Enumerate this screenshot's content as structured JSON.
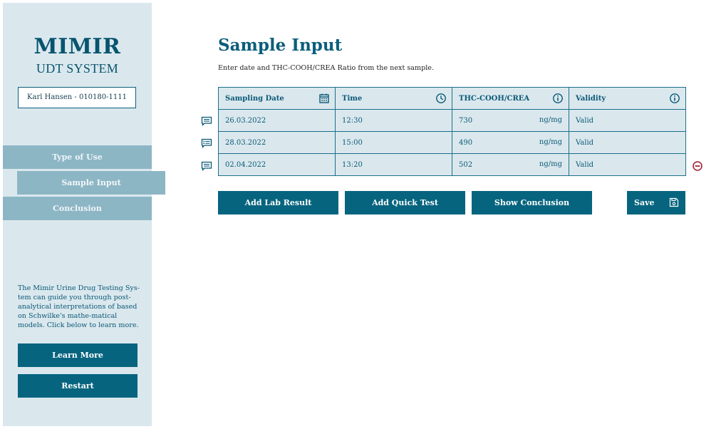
{
  "sidebar": {
    "brand_title": "MIMIR",
    "brand_subtitle": "UDT SYSTEM",
    "patient": "Karl Hansen - 010180-1111",
    "nav": [
      {
        "label": "Type of Use"
      },
      {
        "label": "Sample Input"
      },
      {
        "label": "Conclusion"
      }
    ],
    "info_text": "The Mimir Urine Drug Testing Sys-tem can guide you through post-analytical interpretations of based on Schwilke's mathe-matical models. Click below to learn more.",
    "learn_more": "Learn More",
    "restart": "Restart"
  },
  "main": {
    "title": "Sample Input",
    "subtitle": "Enter date and THC-COOH/CREA Ratio from the next sample.",
    "table": {
      "headers": [
        "Sampling Date",
        "Time",
        "THC-COOH/CREA",
        "Validity"
      ],
      "rows": [
        {
          "date": "26.03.2022",
          "time": "12:30",
          "value": "730",
          "unit": "ng/mg",
          "validity": "Valid"
        },
        {
          "date": "28.03.2022",
          "time": "15:00",
          "value": "490",
          "unit": "ng/mg",
          "validity": "Valid"
        },
        {
          "date": "02.04.2022",
          "time": "13:20",
          "value": "502",
          "unit": "ng/mg",
          "validity": "Valid"
        }
      ]
    },
    "buttons": {
      "add_lab": "Add Lab Result",
      "add_quick": "Add Quick Test",
      "show_conclusion": "Show Conclusion",
      "save": "Save"
    }
  },
  "colors": {
    "primary": "#06647f",
    "sidebar_bg": "#dae8ee",
    "nav_bg": "#8db6c5",
    "remove": "#9b1c2e"
  }
}
